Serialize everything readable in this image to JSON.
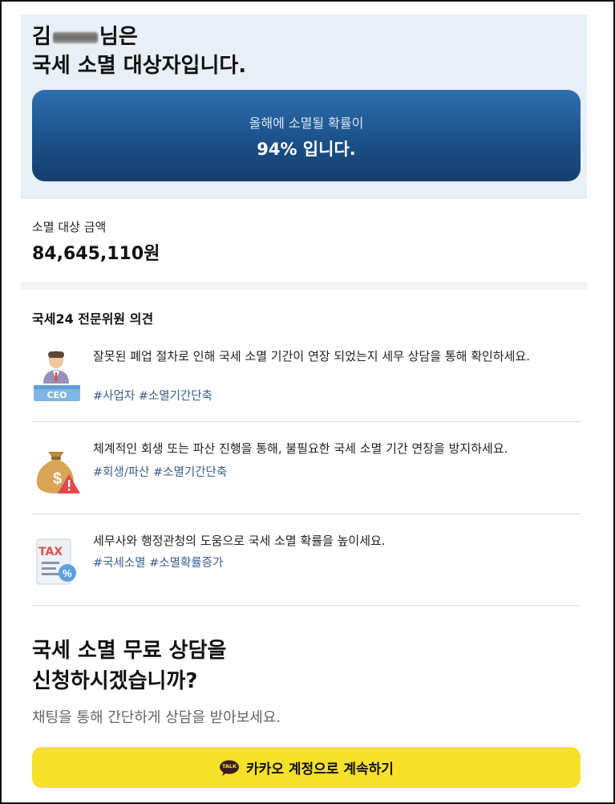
{
  "header": {
    "name_prefix": "김",
    "name_suffix": "님은",
    "title": "국세 소멸 대상자입니다."
  },
  "probability_card": {
    "line1": "올해에 소멸될 확률이",
    "line2": "94% 입니다.",
    "probability_percent": 94
  },
  "amount": {
    "label": "소멸 대상 금액",
    "value": "84,645,110원"
  },
  "opinion": {
    "title": "국세24 전문위원 의견",
    "items": [
      {
        "icon": "ceo-icon",
        "text": "잘못된 폐업 절차로 인해 국세 소멸 기간이 연장 되었는지 세무 상담을 통해 확인하세요.",
        "tags": "#사업자 #소멸기간단축",
        "icon_label": "CEO"
      },
      {
        "icon": "money-bag-warning-icon",
        "text": "체계적인 회생 또는 파산 진행을 통해, 불필요한 국세 소멸 기간 연장을 방지하세요.",
        "tags": "#회생/파산 #소멸기간단축"
      },
      {
        "icon": "tax-document-icon",
        "text": "세무사와 행정관청의 도움으로 국세 소멸 확률을 높이세요.",
        "tags": "#국세소멸 #소멸확률증가",
        "icon_label": "TAX"
      }
    ]
  },
  "cta": {
    "title_line1": "국세 소멸 무료 상담을",
    "title_line2": "신청하시겠습니까?",
    "subtitle": "채팅을 통해 간단하게 상담을 받아보세요.",
    "button_label": "카카오 계정으로 계속하기",
    "button_icon": "kakao-talk-icon",
    "button_icon_text": "TALK"
  },
  "colors": {
    "hero_bg": "#e9eff6",
    "card_blue": "#1a4f86",
    "tag_blue": "#3b5f8c",
    "kakao_yellow": "#f7e12a"
  }
}
